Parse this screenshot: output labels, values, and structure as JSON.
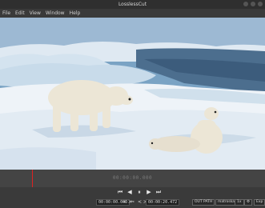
{
  "window": {
    "title": "LosslessCut"
  },
  "menu": {
    "file": "File",
    "edit": "Edit",
    "view": "View",
    "window": "Window",
    "help": "Help"
  },
  "timeline": {
    "time_text": "00:00:00.000"
  },
  "transport": {
    "jump_start_icon": "skip-start-icon",
    "prev_frame_icon": "step-back-icon",
    "play_icon": "pause-icon",
    "next_frame_icon": "step-forward-icon",
    "jump_end_icon": "skip-end-icon"
  },
  "cut": {
    "start_time": "00:00:00.000",
    "end_time": "00:00:20.472",
    "start_buttons": "< >",
    "end_buttons": "< >"
  },
  "export": {
    "out_path": "OUT PATH",
    "format": "matroska",
    "badge1": "1x",
    "export_label": "Exp"
  },
  "colors": {
    "playhead": "#d22222",
    "background": "#2b2b2b"
  }
}
